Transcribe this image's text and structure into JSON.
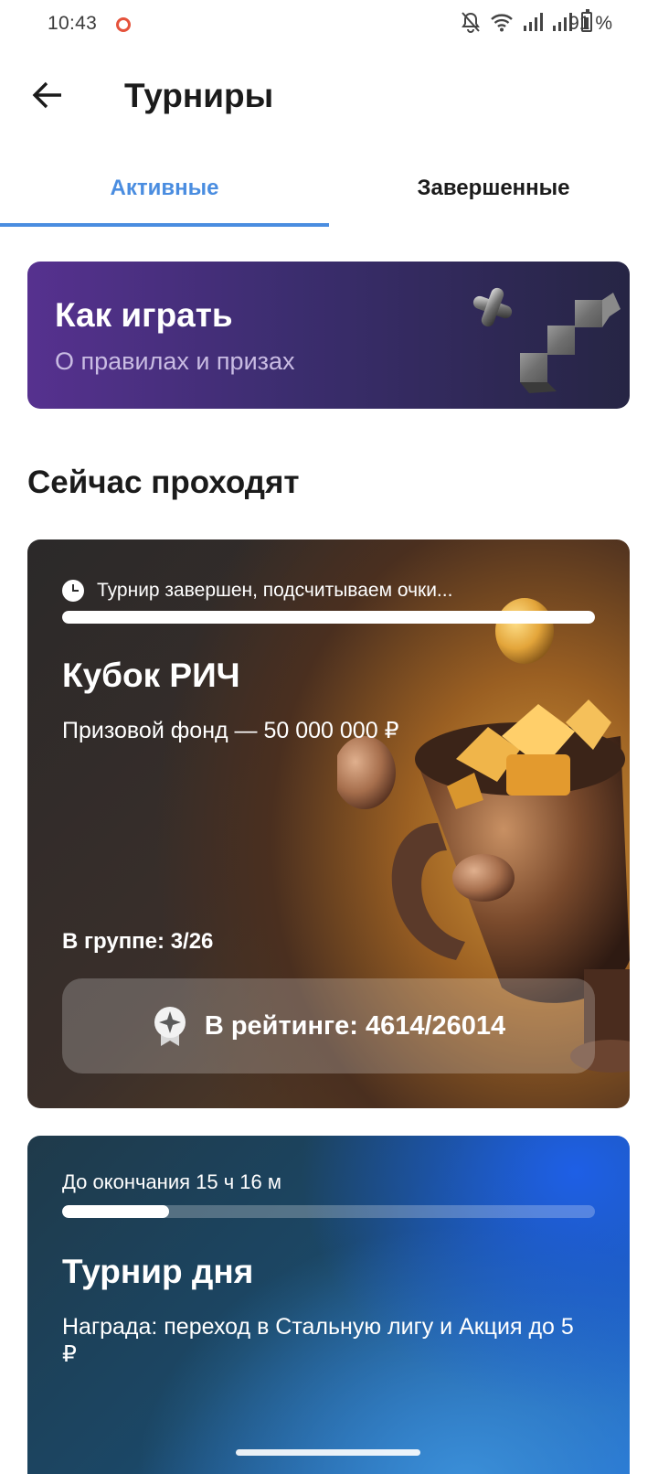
{
  "status_bar": {
    "time": "10:43",
    "battery_text": "91 %"
  },
  "header": {
    "title": "Турниры"
  },
  "tabs": [
    {
      "label": "Активные",
      "active": true
    },
    {
      "label": "Завершенные",
      "active": false
    }
  ],
  "howto": {
    "title": "Как играть",
    "subtitle": "О правилах и призах"
  },
  "section": {
    "title": "Сейчас проходят"
  },
  "tournaments": [
    {
      "status": "Турнир завершен, подсчитываем очки...",
      "progress": 1.0,
      "title": "Кубок РИЧ",
      "prize": "Призовой фонд — 50 000 000 ₽",
      "group": "В группе: 3/26",
      "rating": "В рейтинге: 4614/26014"
    },
    {
      "status": "До окончания 15 ч 16 м",
      "progress": 0.2,
      "title": "Турнир дня",
      "description": "Награда: переход в Стальную лигу и Акция до 5 ₽"
    }
  ],
  "colors": {
    "accent": "#4a8de0",
    "howto_gradient_start": "#56318f",
    "card2_blue": "#1d6ad6"
  }
}
